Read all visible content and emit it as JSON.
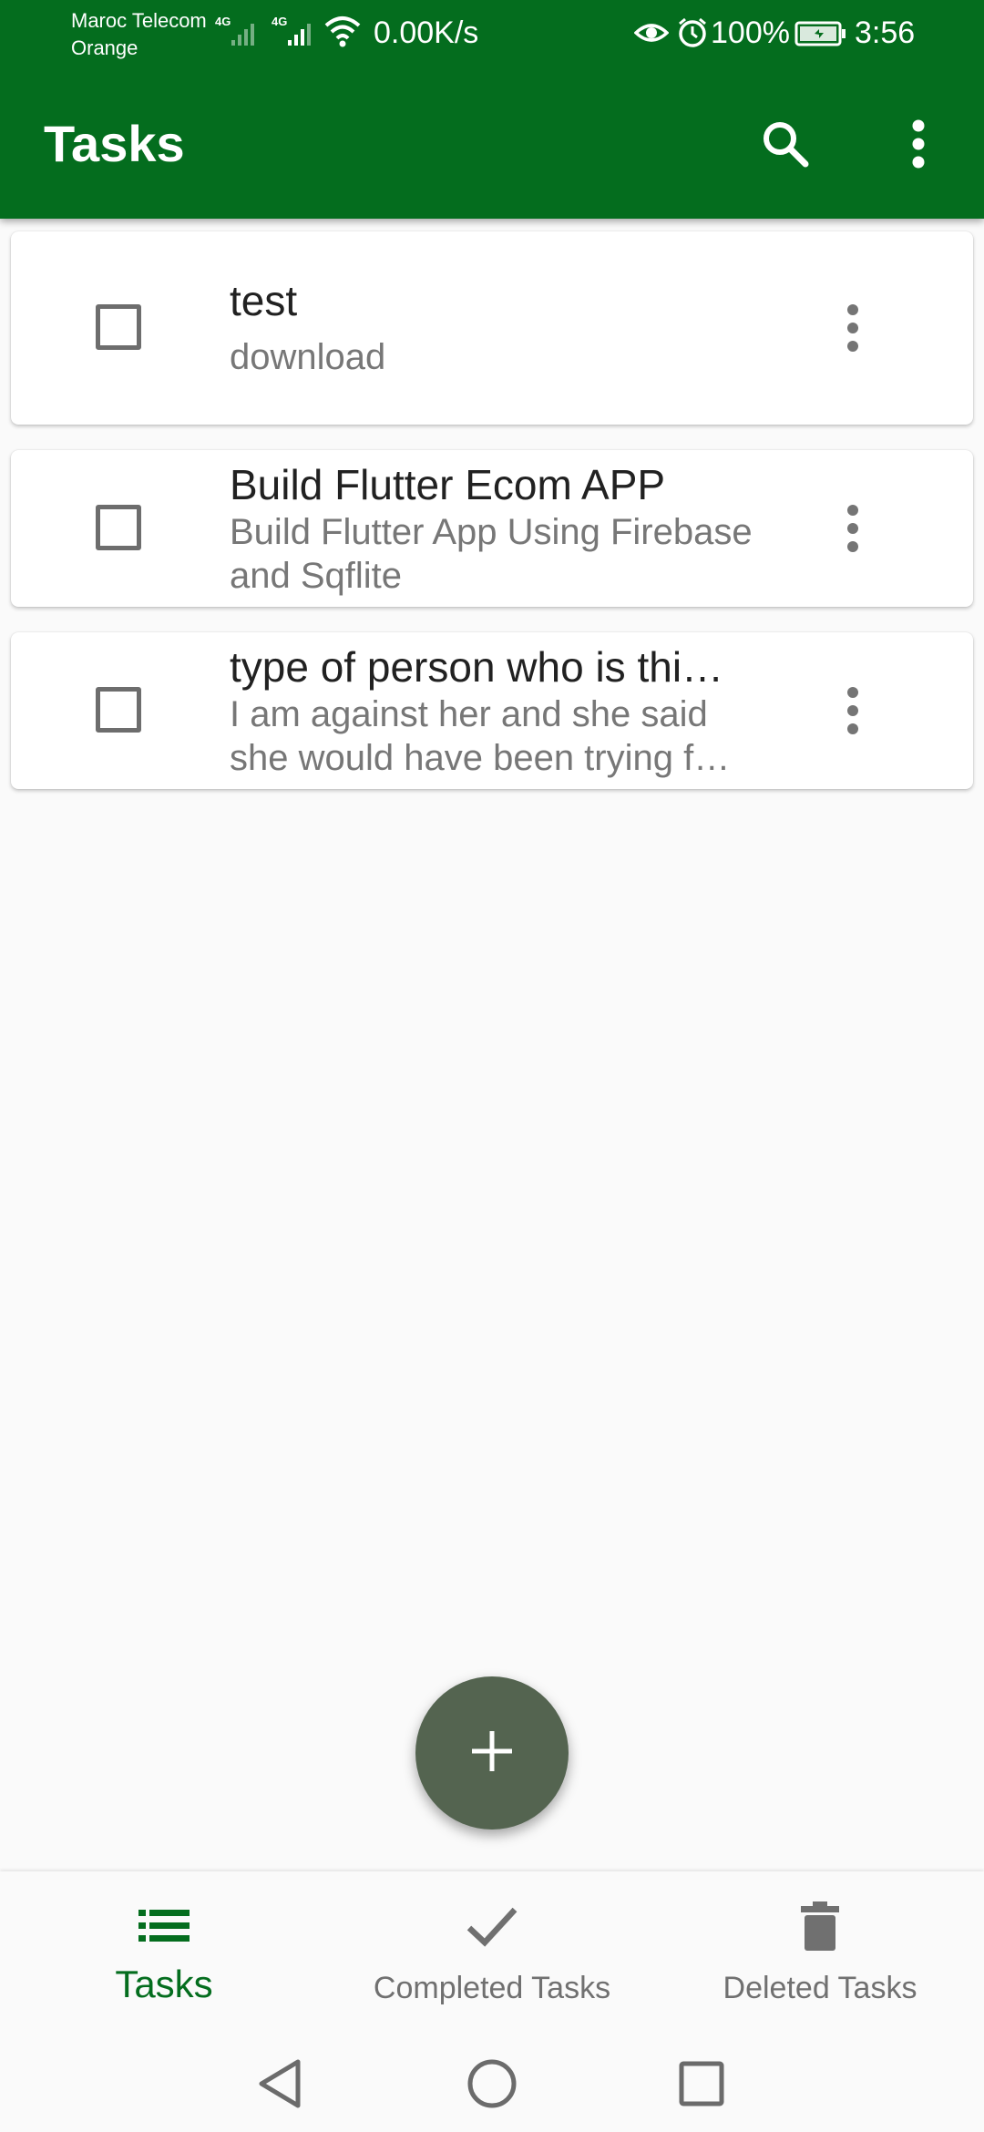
{
  "status_bar": {
    "carrier_line1": "Maroc Telecom",
    "carrier_line2": "Orange",
    "network_type_1": "4G",
    "network_type_2": "4G",
    "speed": "0.00K/s",
    "battery": "100%",
    "time": "3:56",
    "icons": [
      "signal-icon",
      "wifi-icon",
      "eye-icon",
      "alarm-icon",
      "battery-icon"
    ]
  },
  "app_bar": {
    "title": "Tasks",
    "actions": [
      "search-icon",
      "more-vert-icon"
    ]
  },
  "tasks": [
    {
      "title": "test",
      "description": "download",
      "checked": false
    },
    {
      "title": "Build Flutter Ecom APP",
      "description": "Build Flutter App Using Firebase and Sqflite",
      "checked": false
    },
    {
      "title": "type of person who is thi…",
      "description": "I am against her and she said she would have been trying f…",
      "checked": false
    }
  ],
  "fab": {
    "icon": "plus-icon"
  },
  "bottom_nav": {
    "items": [
      {
        "label": "Tasks",
        "icon": "list-icon",
        "active": true
      },
      {
        "label": "Completed Tasks",
        "icon": "check-icon",
        "active": false
      },
      {
        "label": "Deleted Tasks",
        "icon": "trash-icon",
        "active": false
      }
    ]
  },
  "system_nav": {
    "icons": [
      "back-icon",
      "home-icon",
      "recents-icon"
    ]
  },
  "colors": {
    "primary": "#046d1e",
    "background": "#fafafa",
    "fab": "#546450",
    "active_nav": "#046d1e",
    "inactive_nav": "#707070"
  }
}
